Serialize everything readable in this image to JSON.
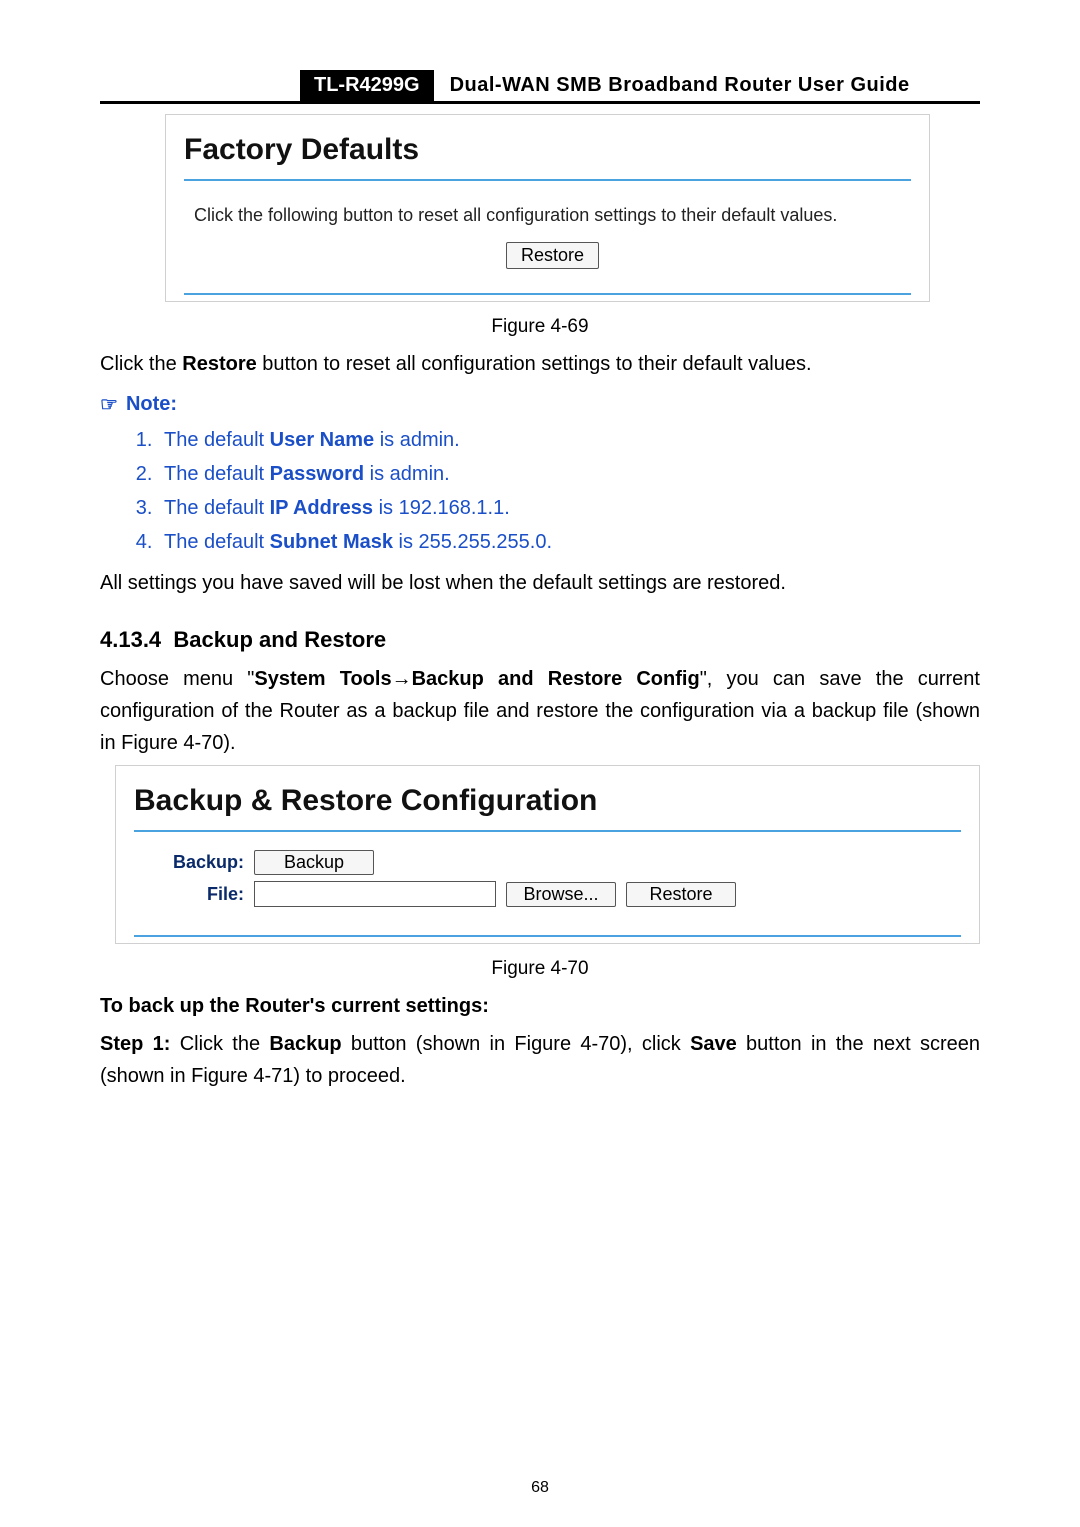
{
  "header": {
    "model": "TL-R4299G",
    "title": "Dual-WAN SMB Broadband Router User Guide"
  },
  "panel1": {
    "title": "Factory Defaults",
    "desc": "Click the following button to reset all configuration settings to their default values.",
    "restore_btn": "Restore"
  },
  "caption1": "Figure 4-69",
  "restore_line_pre": "Click the ",
  "restore_line_bold": "Restore",
  "restore_line_post": " button to reset all configuration settings to their default values.",
  "note": {
    "label": "Note:",
    "items": [
      {
        "pre": "The default ",
        "bold": "User Name",
        "post": " is admin."
      },
      {
        "pre": "The default ",
        "bold": "Password",
        "post": " is admin."
      },
      {
        "pre": "The default ",
        "bold": "IP Address",
        "post": " is 192.168.1.1."
      },
      {
        "pre": "The default ",
        "bold": "Subnet Mask",
        "post": " is 255.255.255.0."
      }
    ]
  },
  "lost_line": "All settings you have saved will be lost when the default settings are restored.",
  "section": {
    "num": "4.13.4",
    "title": "Backup and Restore"
  },
  "choose_line": {
    "p1": "Choose menu \"",
    "b1": "System Tools",
    "arrow": "→",
    "b2": "Backup and Restore Config",
    "p2": "\", you can save the current configuration of the Router as a backup file and restore the configuration via a backup file (shown in Figure 4-70)."
  },
  "panel2": {
    "title": "Backup & Restore Configuration",
    "backup_label": "Backup:",
    "backup_btn": "Backup",
    "file_label": "File:",
    "browse_btn": "Browse...",
    "restore_btn": "Restore"
  },
  "caption2": "Figure 4-70",
  "backup_head": "To back up the Router's current settings:",
  "step1": {
    "label": "Step 1:",
    "p1": "Click the ",
    "b1": "Backup",
    "p2": " button (shown in Figure 4-70), click ",
    "b2": "Save",
    "p3": " button in the next screen (shown in Figure 4-71) to proceed."
  },
  "page_number": "68"
}
